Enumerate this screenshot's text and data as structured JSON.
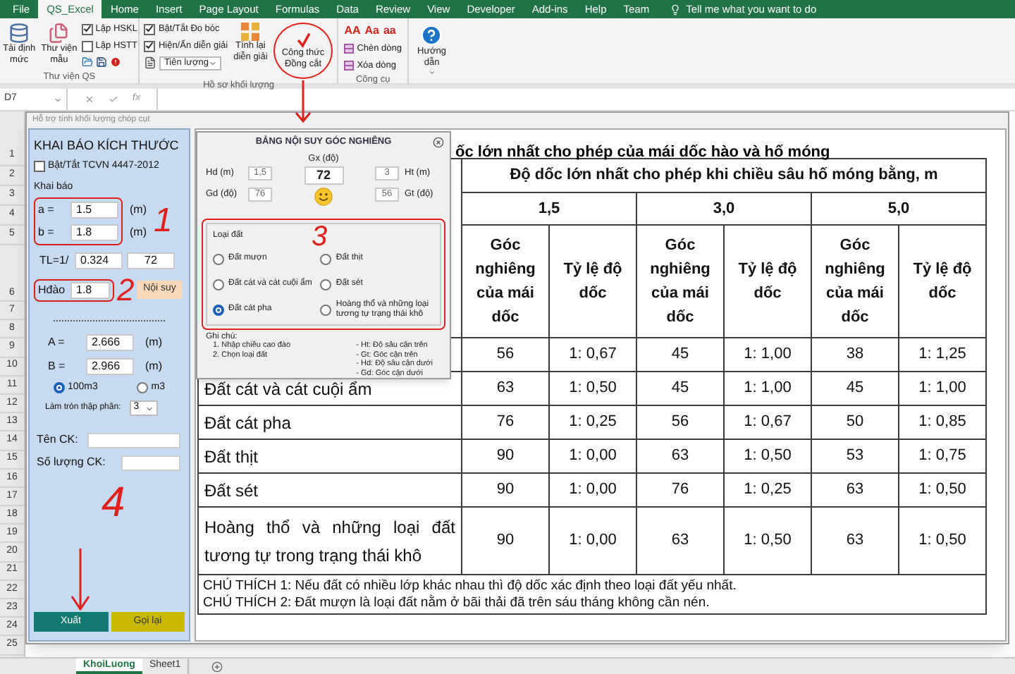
{
  "ribbon_tabs": [
    {
      "label": "File",
      "selected": false
    },
    {
      "label": "QS_Excel",
      "selected": true
    },
    {
      "label": "Home",
      "selected": false
    },
    {
      "label": "Insert",
      "selected": false
    },
    {
      "label": "Page Layout",
      "selected": false
    },
    {
      "label": "Formulas",
      "selected": false
    },
    {
      "label": "Data",
      "selected": false
    },
    {
      "label": "Review",
      "selected": false
    },
    {
      "label": "View",
      "selected": false
    },
    {
      "label": "Developer",
      "selected": false
    },
    {
      "label": "Add-ins",
      "selected": false
    },
    {
      "label": "Help",
      "selected": false
    },
    {
      "label": "Team",
      "selected": false
    }
  ],
  "tell_me": "Tell me what you want to do",
  "ribbon_groups": {
    "library": {
      "label": "Thư viện QS",
      "big_buttons": [
        "Tải định\nmức",
        "Thư viện\nmẫu"
      ],
      "checkboxes": [
        {
          "label": "Lập HSKL",
          "checked": true
        },
        {
          "label": "Lập HSTT",
          "checked": false
        }
      ]
    },
    "records": {
      "label": "Hồ sơ khối lượng",
      "checkboxes": [
        {
          "label": "Bật/Tắt Đo bóc",
          "checked": true
        },
        {
          "label": "Hiện/Ẩn diễn giải",
          "checked": true
        }
      ],
      "dropdown": "Tiên lượng",
      "big_buttons": [
        "Tính lại\ndiễn giải",
        "Công thức\nĐồng cắt"
      ]
    },
    "tools": {
      "label": "Công cụ",
      "case_buttons": [
        "AA",
        "Aa",
        "aa"
      ],
      "buttons": [
        "Chèn dòng",
        "Xóa dòng"
      ]
    },
    "help": {
      "label": "Hướng\ndẫn"
    }
  },
  "formula_bar": {
    "name_box": "D7",
    "fx": "fx"
  },
  "row_numbers": [
    "1",
    "2",
    "3",
    "4",
    "5",
    "6",
    "7",
    "8",
    "9",
    "10",
    "11",
    "12",
    "13",
    "14",
    "15",
    "16",
    "17",
    "18",
    "19",
    "20",
    "21",
    "22",
    "23",
    "24",
    "25"
  ],
  "sheet_tabs": [
    {
      "label": "KhoiLuong",
      "selected": true
    },
    {
      "label": "Sheet1",
      "selected": false
    }
  ],
  "form": {
    "title": "Hỗ trợ tính khối lượng chóp cụt",
    "heading": "KHAI BÁO KÍCH THƯỚC",
    "tcvn": {
      "label": "Bật/Tắt TCVN 4447-2012",
      "checked": false
    },
    "section": "Khai báo",
    "a": {
      "label": "a =",
      "value": "1.5",
      "unit": "(m)"
    },
    "b": {
      "label": "b =",
      "value": "1.8",
      "unit": "(m)"
    },
    "tl": {
      "label": "TL=1/",
      "value": "0.324",
      "angle": "72"
    },
    "depth": {
      "label": "Hđào",
      "value": "1.8",
      "button": "Nội suy"
    },
    "big_a": {
      "label": "A =",
      "value": "2.666",
      "unit": "(m)"
    },
    "big_b": {
      "label": "B =",
      "value": "2.966",
      "unit": "(m)"
    },
    "units": [
      {
        "label": "100m3",
        "selected": true
      },
      {
        "label": "m3",
        "selected": false
      }
    ],
    "rounding": {
      "label": "Làm tròn thập phân:",
      "value": "3"
    },
    "name_field": {
      "label": "Tên CK:"
    },
    "count_field": {
      "label": "Số lượng CK:"
    },
    "buttons": [
      {
        "label": "Xuất",
        "kind": "primary"
      },
      {
        "label": "Gọi lại",
        "kind": "secondary"
      }
    ]
  },
  "dialog": {
    "title": "BẢNG NỘI SUY GÓC NGHIÊNG",
    "hd": {
      "label": "Hd (m)",
      "value": "1,5"
    },
    "gd": {
      "label": "Gd (độ)",
      "value": "76"
    },
    "gx": {
      "label": "Gx (độ)",
      "value": "72"
    },
    "ht": {
      "label": "Ht (m)",
      "value": "3"
    },
    "gt": {
      "label": "Gt (độ)",
      "value": "56"
    },
    "soil_group": "Loại đất",
    "soils": [
      {
        "label": "Đất mượn",
        "selected": false
      },
      {
        "label": "Đất cát và cát cuội ẩm",
        "selected": false
      },
      {
        "label": "Đất cát pha",
        "selected": true
      },
      {
        "label": "Đất thịt",
        "selected": false
      },
      {
        "label": "Đất sét",
        "selected": false
      },
      {
        "label": "Hoàng thổ và những loại tương tự trạng thái khô",
        "selected": false
      }
    ],
    "notes_label": "Ghi chú:",
    "steps": [
      "1. Nhập chiều cao đào",
      "2. Chọn loại đất"
    ],
    "legend": [
      "- Ht: Độ sâu cận trên",
      "- Gt: Góc cận trên",
      "- Hd: Độ sâu cận dưới",
      "- Gd: Góc cận dưới"
    ]
  },
  "table": {
    "title": "ốc lớn nhất cho phép của mái dốc hào và hố móng",
    "group_header": "Độ dốc lớn nhất cho phép khi chiều sâu hố móng bằng, m",
    "depths": [
      "1,5",
      "3,0",
      "5,0"
    ],
    "sub_headers": [
      "Góc nghiêng của mái dốc",
      "Tỷ lệ độ dốc",
      "Góc nghiêng của mái dốc",
      "Tỷ lệ độ dốc",
      "Góc nghiêng của mái dốc",
      "Tỷ lệ độ dốc"
    ],
    "rows": [
      {
        "values": [
          "56",
          "1: 0,67",
          "45",
          "1: 1,00",
          "38",
          "1: 1,25"
        ]
      },
      {
        "soil": "Đất cát và cát cuội ẩm",
        "values": [
          "63",
          "1: 0,50",
          "45",
          "1: 1,00",
          "45",
          "1: 1,00"
        ]
      },
      {
        "soil": "Đất cát pha",
        "values": [
          "76",
          "1: 0,25",
          "56",
          "1: 0,67",
          "50",
          "1: 0,85"
        ]
      },
      {
        "soil": "Đất thịt",
        "values": [
          "90",
          "1: 0,00",
          "63",
          "1: 0,50",
          "53",
          "1: 0,75"
        ]
      },
      {
        "soil": "Đất sét",
        "values": [
          "90",
          "1: 0,00",
          "76",
          "1: 0,25",
          "63",
          "1: 0,50"
        ]
      },
      {
        "soil": "Hoàng thổ và những loại đất tương tự trong trạng thái khô",
        "values": [
          "90",
          "1: 0,00",
          "63",
          "1: 0,50",
          "63",
          "1: 0,50"
        ]
      }
    ],
    "notes": [
      "CHÚ THÍCH 1: Nếu đất có nhiều lớp khác nhau thì độ dốc xác định theo loại đất yếu nhất.",
      "CHÚ THÍCH 2: Đất mượn là loại đất nằm ở bãi thải đã trên sáu tháng không cần nén."
    ]
  },
  "annotations": [
    "1",
    "2",
    "3",
    "4"
  ]
}
